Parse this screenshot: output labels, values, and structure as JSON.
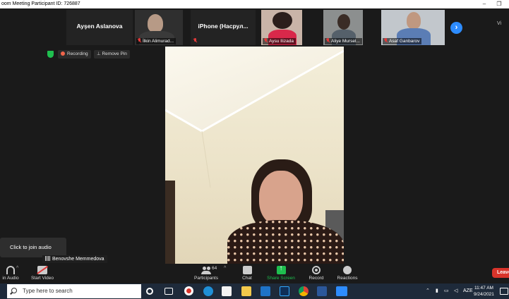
{
  "window": {
    "title": "oom Meeting Participant ID: 726887",
    "minimize": "–",
    "restore": "❐"
  },
  "gallery": {
    "tiles": [
      {
        "name": "Ayşen Aslanova",
        "kind": "name"
      },
      {
        "name": "İlkin Alimurad...",
        "kind": "video"
      },
      {
        "name": "iPhone (Насрул...",
        "kind": "name"
      },
      {
        "name": "Aysu Ilizada",
        "kind": "video"
      },
      {
        "name": "Aliye Mursel...",
        "kind": "video"
      },
      {
        "name": "Asaf Ganbarov",
        "kind": "video"
      }
    ],
    "next": "›",
    "view": "Vi"
  },
  "status": {
    "recording": "Recording",
    "remove_pin": "Remove Pin"
  },
  "audio_popover": "Click to join audio",
  "self_label": "Benovshe Memmedova",
  "toolbar": {
    "join_audio": "in Audio",
    "start_video": "Start Video",
    "participants": "Participants",
    "participants_count": "64",
    "chat": "Chat",
    "share_screen": "Share Screen",
    "record": "Record",
    "reactions": "Reactions",
    "leave": "Leave",
    "caret": "^"
  },
  "taskbar": {
    "search_placeholder": "Type here to search",
    "language": "AZE",
    "time": "11:47 AM",
    "date": "9/24/2021"
  },
  "colors": {
    "accent": "#2d8cff",
    "share": "#1fbf4f",
    "leave": "#d9342b",
    "muted": "#e23a3a"
  }
}
